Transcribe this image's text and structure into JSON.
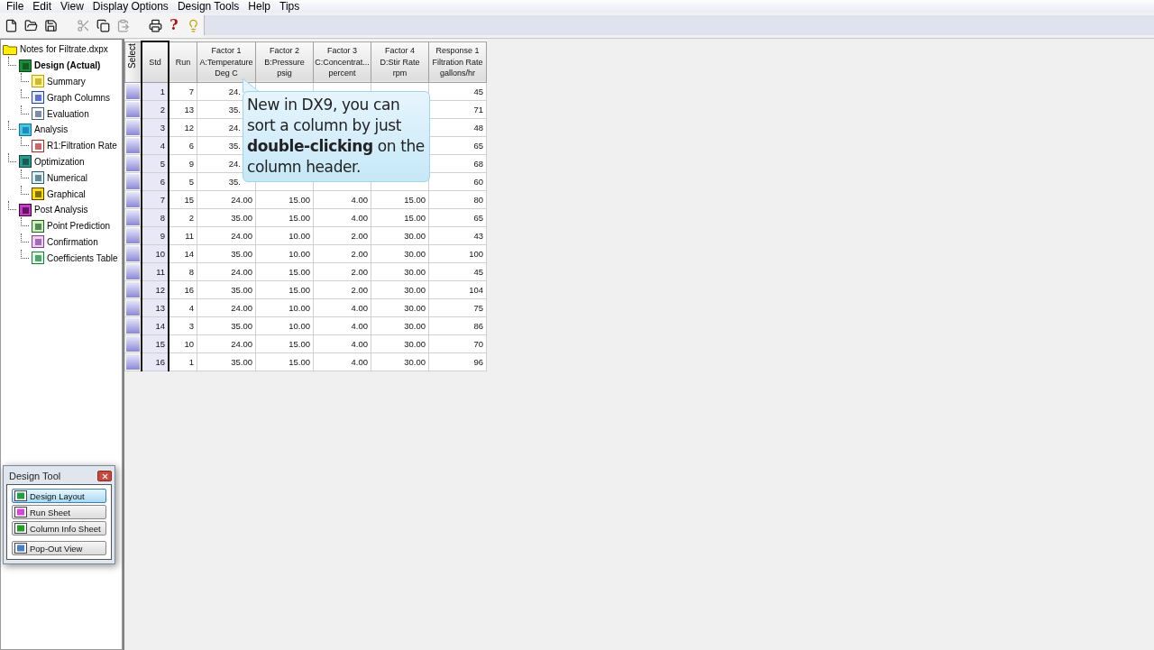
{
  "menu": [
    "File",
    "Edit",
    "View",
    "Display Options",
    "Design Tools",
    "Help",
    "Tips"
  ],
  "toolbar": [
    {
      "kind": "new"
    },
    {
      "kind": "open"
    },
    {
      "kind": "save"
    },
    {
      "kind": "cut",
      "disabled": true
    },
    {
      "kind": "copy",
      "disabled": false
    },
    {
      "kind": "paste",
      "disabled": true
    },
    {
      "kind": "print"
    },
    {
      "kind": "help",
      "label": "?"
    },
    {
      "kind": "tip"
    }
  ],
  "tree": {
    "label": "Notes for Filtrate.dxpx",
    "children": [
      {
        "label": "Design (Actual)",
        "selected": true,
        "children": [
          {
            "label": "Summary",
            "selected": false
          },
          {
            "label": "Graph Columns",
            "selected": false
          },
          {
            "label": "Evaluation",
            "selected": false
          }
        ]
      },
      {
        "label": "Analysis",
        "selected": false,
        "children": [
          {
            "label": "R1:Filtration Rate",
            "selected": false
          }
        ]
      },
      {
        "label": "Optimization",
        "selected": false,
        "children": [
          {
            "label": "Numerical",
            "selected": false
          },
          {
            "label": "Graphical",
            "selected": false
          }
        ]
      },
      {
        "label": "Post Analysis",
        "selected": false,
        "children": [
          {
            "label": "Point Prediction",
            "selected": false
          },
          {
            "label": "Confirmation",
            "selected": false
          },
          {
            "label": "Coefficients Table",
            "selected": false
          }
        ]
      }
    ]
  },
  "table": {
    "select_header": "Select",
    "std_header": "Std",
    "run_header": "Run",
    "columns": [
      [
        "Factor 1",
        "A:Temperature",
        "Deg C"
      ],
      [
        "Factor 2",
        "B:Pressure",
        "psig"
      ],
      [
        "Factor 3",
        "C:Concentrat...",
        "percent"
      ],
      [
        "Factor 4",
        "D:Stir Rate",
        "rpm"
      ],
      [
        "Response 1",
        "Filtration Rate",
        "gallons/hr"
      ]
    ],
    "rows": [
      {
        "std": "1",
        "run": "7",
        "factor_1": "24.",
        "response_1": "45"
      },
      {
        "std": "2",
        "run": "13",
        "factor_1": "35.",
        "response_1": "71"
      },
      {
        "std": "3",
        "run": "12",
        "factor_1": "24.",
        "response_1": "48"
      },
      {
        "std": "4",
        "run": "6",
        "factor_1": "35.",
        "response_1": "65"
      },
      {
        "std": "5",
        "run": "9",
        "factor_1": "24.",
        "response_1": "68"
      },
      {
        "std": "6",
        "run": "5",
        "factor_1": "35.",
        "response_1": "60"
      },
      {
        "std": "7",
        "run": "15",
        "factor_1": "24.00",
        "factor_2": "15.00",
        "factor_3": "4.00",
        "factor_4": "15.00",
        "response_1": "80"
      },
      {
        "std": "8",
        "run": "2",
        "factor_1": "35.00",
        "factor_2": "15.00",
        "factor_3": "4.00",
        "factor_4": "15.00",
        "response_1": "65"
      },
      {
        "std": "9",
        "run": "11",
        "factor_1": "24.00",
        "factor_2": "10.00",
        "factor_3": "2.00",
        "factor_4": "30.00",
        "response_1": "43"
      },
      {
        "std": "10",
        "run": "14",
        "factor_1": "35.00",
        "factor_2": "10.00",
        "factor_3": "2.00",
        "factor_4": "30.00",
        "response_1": "100"
      },
      {
        "std": "11",
        "run": "8",
        "factor_1": "24.00",
        "factor_2": "15.00",
        "factor_3": "2.00",
        "factor_4": "30.00",
        "response_1": "45"
      },
      {
        "std": "12",
        "run": "16",
        "factor_1": "35.00",
        "factor_2": "15.00",
        "factor_3": "2.00",
        "factor_4": "30.00",
        "response_1": "104"
      },
      {
        "std": "13",
        "run": "4",
        "factor_1": "24.00",
        "factor_2": "10.00",
        "factor_3": "4.00",
        "factor_4": "30.00",
        "response_1": "75"
      },
      {
        "std": "14",
        "run": "3",
        "factor_1": "35.00",
        "factor_2": "10.00",
        "factor_3": "4.00",
        "factor_4": "30.00",
        "response_1": "86"
      },
      {
        "std": "15",
        "run": "10",
        "factor_1": "24.00",
        "factor_2": "15.00",
        "factor_3": "4.00",
        "factor_4": "30.00",
        "response_1": "70"
      },
      {
        "std": "16",
        "run": "1",
        "factor_1": "35.00",
        "factor_2": "15.00",
        "factor_3": "4.00",
        "factor_4": "30.00",
        "response_1": "96"
      }
    ]
  },
  "callout": "New in DX9, you can sort a column by just **double-clicking** on the column header.",
  "design_tool": {
    "title": "Design Tool",
    "buttons": [
      {
        "label": "Design Layout",
        "selected": true
      },
      {
        "label": "Run Sheet",
        "selected": false
      },
      {
        "label": "Column Info Sheet",
        "selected": false
      },
      {
        "label": "Pop-Out View",
        "selected": false
      }
    ]
  }
}
